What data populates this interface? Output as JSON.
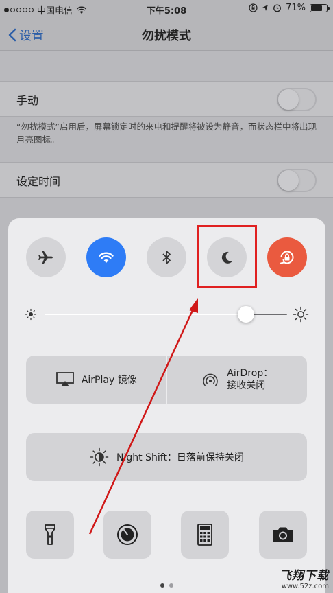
{
  "status_bar": {
    "carrier": "中国电信",
    "time": "下午5:08",
    "battery_percent": "71%",
    "battery_level": 0.71
  },
  "nav": {
    "back_label": "设置",
    "title": "勿扰模式"
  },
  "settings": {
    "manual_label": "手动",
    "manual_on": false,
    "note": "“勿扰模式”启用后，屏幕锁定时的来电和提醒将被设为静音，而状态栏中将出现月亮图标。",
    "scheduled_label": "设定时间",
    "scheduled_on": false
  },
  "control_center": {
    "toggles": [
      {
        "name": "airplane-mode",
        "icon": "airplane-icon",
        "on": false
      },
      {
        "name": "wifi",
        "icon": "wifi-icon",
        "on": true,
        "color": "#2e7cf6"
      },
      {
        "name": "bluetooth",
        "icon": "bluetooth-icon",
        "on": false
      },
      {
        "name": "do-not-disturb",
        "icon": "moon-icon",
        "on": false,
        "highlighted": true
      },
      {
        "name": "rotation-lock",
        "icon": "rotation-lock-icon",
        "on": true,
        "color": "#ea5a3f"
      }
    ],
    "brightness_level": 0.83,
    "airplay_label": "AirPlay 镜像",
    "airdrop_line1": "AirDrop：",
    "airdrop_line2": "接收关闭",
    "night_shift_label": "Night Shift：日落前保持关闭",
    "tools": [
      {
        "name": "flashlight",
        "icon": "flashlight-icon"
      },
      {
        "name": "timer",
        "icon": "timer-icon"
      },
      {
        "name": "calculator",
        "icon": "calculator-icon"
      },
      {
        "name": "camera",
        "icon": "camera-icon"
      }
    ],
    "page_count": 2,
    "current_page": 1
  },
  "annotation": {
    "highlight_color": "#e02020"
  },
  "watermark": {
    "brand": "飞翔下载",
    "url": "www.52z.com"
  }
}
